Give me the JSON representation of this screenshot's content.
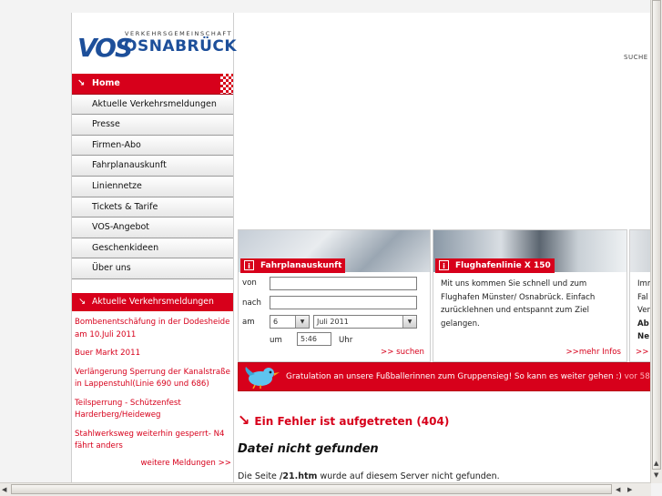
{
  "logo": {
    "mark": "VOS",
    "tagline": "VERKEHRSGEMEINSCHAFT",
    "name": "OSNABRÜCK"
  },
  "search_label": "SUCHE",
  "nav": [
    {
      "label": "Home",
      "active": true
    },
    {
      "label": "Aktuelle Verkehrsmeldungen"
    },
    {
      "label": "Presse"
    },
    {
      "label": "Firmen-Abo"
    },
    {
      "label": "Fahrplanauskunft"
    },
    {
      "label": "Liniennetze"
    },
    {
      "label": "Tickets & Tarife"
    },
    {
      "label": "VOS-Angebot"
    },
    {
      "label": "Geschenkideen"
    },
    {
      "label": "Über uns"
    }
  ],
  "messages": {
    "heading": "Aktuelle Verkehrsmeldungen",
    "items": [
      "Bombenentschäfung in der Dodesheide am 10.Juli 2011",
      "Buer Markt 2011",
      "Verlängerung Sperrung der Kanalstraße in Lappenstuhl(Linie 690 und 686)",
      "Teilsperrung - Schützenfest Harderberg/Heideweg",
      "Stahlwerksweg weiterhin gesperrt- N4 fährt anders"
    ],
    "more": "weitere Meldungen >>"
  },
  "fahrplan": {
    "heading": "Fahrplanauskunft",
    "von": "von",
    "nach": "nach",
    "am": "am",
    "um": "um",
    "uhr": "Uhr",
    "day": "6",
    "month": "Juli 2011",
    "time": "5:46",
    "submit": ">> suchen"
  },
  "flughafen": {
    "heading": "Flughafenlinie X 150",
    "text": "Mit uns kommen Sie schnell und zum Flughafen Münster/ Osnabrück. Einfach zurücklehnen und entspannt zum Ziel gelangen.",
    "more": ">>mehr Infos"
  },
  "third": {
    "lines": [
      "Imm",
      "Fal",
      "Ver",
      "Ab",
      "Ne"
    ],
    "more": ">> J"
  },
  "ticker": {
    "text": "Gratulation an unsere Fußballerinnen zum Gruppensieg! So kann es weiter gehen :)",
    "ago": "vor 58"
  },
  "error": {
    "title": "Ein Fehler ist aufgetreten (404)",
    "subtitle": "Datei nicht gefunden",
    "text_before": "Die Seite ",
    "file": "/21.htm",
    "text_after": " wurde auf diesem Server nicht gefunden."
  },
  "colors": {
    "brand_red": "#d7001b",
    "brand_blue": "#1d4f9a"
  }
}
